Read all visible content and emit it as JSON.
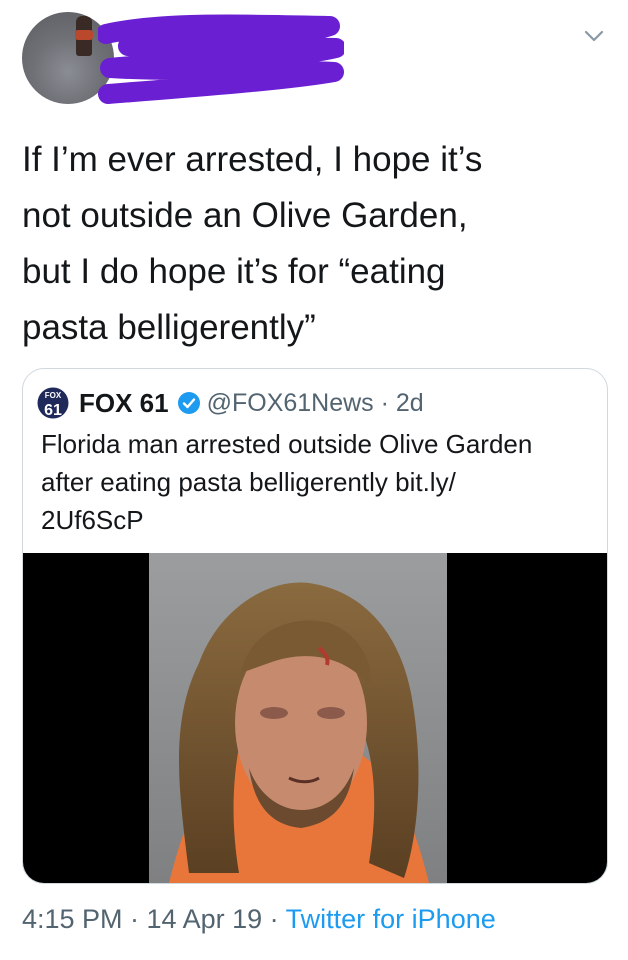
{
  "header": {
    "avatar_icon": "user-avatar-icon",
    "redaction_color": "#6b1fd3",
    "menu_icon": "chevron-down-icon"
  },
  "tweet": {
    "text": "If I’m ever arrested, I hope it’s\nnot outside an Olive Garden,\nbut I do hope it’s for “eating\npasta belligerently”"
  },
  "quoted": {
    "logo_icon": "fox61-logo-icon",
    "name": "FOX 61",
    "verified_icon": "verified-badge-icon",
    "handle_time": "@FOX61News · 2d",
    "text": "Florida man arrested outside Olive Garden\nafter eating pasta belligerently bit.ly/\n2Uf6ScP",
    "media_icon": "mugshot-photo"
  },
  "footer": {
    "time_date": "4:15 PM · 14 Apr 19 · ",
    "source": "Twitter for iPhone"
  },
  "colors": {
    "link": "#1d9bf0",
    "secondary": "#536471",
    "text": "#14171a"
  }
}
